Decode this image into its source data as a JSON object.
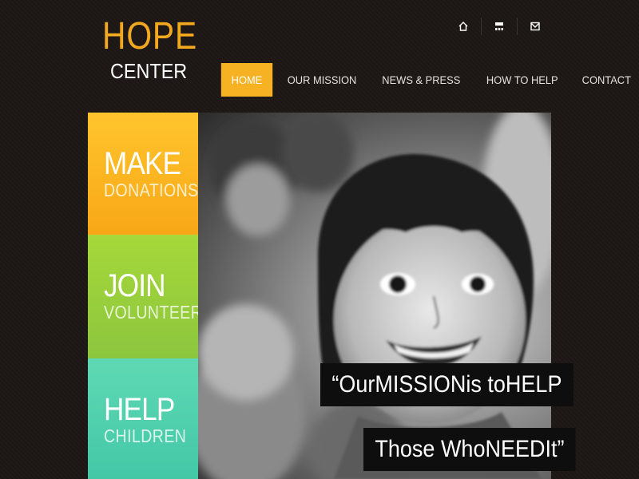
{
  "logo": {
    "line1": "HOPE",
    "line2": "CENTER"
  },
  "utility_icons": [
    "home-icon",
    "sitemap-icon",
    "mail-icon"
  ],
  "nav": {
    "items": [
      {
        "label": "HOME",
        "active": true
      },
      {
        "label": "OUR MISSION",
        "active": false
      },
      {
        "label": "NEWS & PRESS",
        "active": false
      },
      {
        "label": "HOW TO HELP",
        "active": false
      },
      {
        "label": "CONTACT",
        "active": false
      }
    ]
  },
  "tiles": [
    {
      "title": "MAKE",
      "subtitle": "DONATIONS",
      "color": "#f8a716"
    },
    {
      "title": "JOIN",
      "subtitle": "VOLUNTEER",
      "color": "#8cc63e"
    },
    {
      "title": "HELP",
      "subtitle": "CHILDREN",
      "color": "#43c7a6"
    }
  ],
  "hero": {
    "quote_line1": "“OurMISSIONis toHELP",
    "quote_line2": "Those WhoNEEDIt”"
  },
  "colors": {
    "accent": "#f6b222",
    "background": "#1c1614"
  }
}
